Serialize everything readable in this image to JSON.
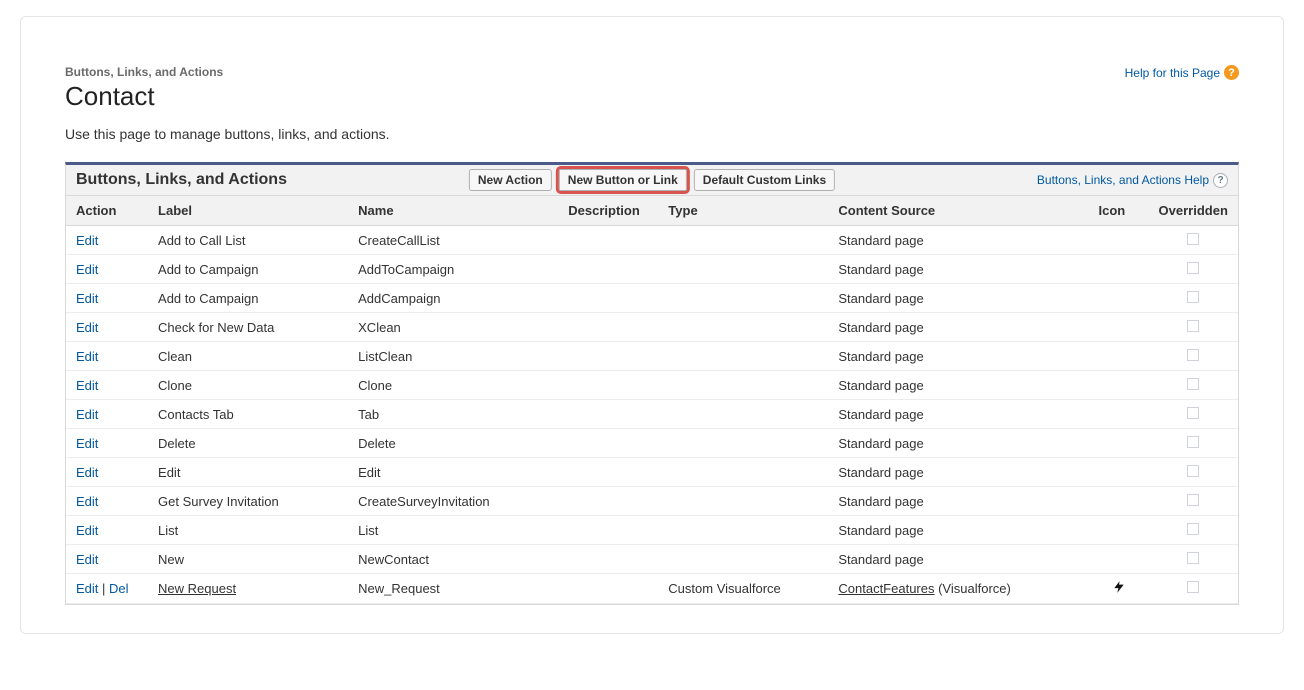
{
  "header": {
    "breadcrumb": "Buttons, Links, and Actions",
    "title": "Contact",
    "help_label": "Help for this Page"
  },
  "intro": "Use this page to manage buttons, links, and actions.",
  "panel": {
    "title": "Buttons, Links, and Actions",
    "buttons": {
      "new_action": "New Action",
      "new_button_link": "New Button or Link",
      "default_custom_links": "Default Custom Links"
    },
    "help_label": "Buttons, Links, and Actions Help"
  },
  "table": {
    "headers": {
      "action": "Action",
      "label": "Label",
      "name": "Name",
      "description": "Description",
      "type": "Type",
      "content_source": "Content Source",
      "icon": "Icon",
      "overridden": "Overridden"
    },
    "action_labels": {
      "edit": "Edit",
      "del": "Del",
      "sep": " | "
    },
    "rows": [
      {
        "actions": [
          "edit"
        ],
        "label": "Add to Call List",
        "name": "CreateCallList",
        "description": "",
        "type": "",
        "content_source": "Standard page",
        "src_link": false,
        "icon": "",
        "label_link": false
      },
      {
        "actions": [
          "edit"
        ],
        "label": "Add to Campaign",
        "name": "AddToCampaign",
        "description": "",
        "type": "",
        "content_source": "Standard page",
        "src_link": false,
        "icon": "",
        "label_link": false
      },
      {
        "actions": [
          "edit"
        ],
        "label": "Add to Campaign",
        "name": "AddCampaign",
        "description": "",
        "type": "",
        "content_source": "Standard page",
        "src_link": false,
        "icon": "",
        "label_link": false
      },
      {
        "actions": [
          "edit"
        ],
        "label": "Check for New Data",
        "name": "XClean",
        "description": "",
        "type": "",
        "content_source": "Standard page",
        "src_link": false,
        "icon": "",
        "label_link": false
      },
      {
        "actions": [
          "edit"
        ],
        "label": "Clean",
        "name": "ListClean",
        "description": "",
        "type": "",
        "content_source": "Standard page",
        "src_link": false,
        "icon": "",
        "label_link": false
      },
      {
        "actions": [
          "edit"
        ],
        "label": "Clone",
        "name": "Clone",
        "description": "",
        "type": "",
        "content_source": "Standard page",
        "src_link": false,
        "icon": "",
        "label_link": false
      },
      {
        "actions": [
          "edit"
        ],
        "label": "Contacts Tab",
        "name": "Tab",
        "description": "",
        "type": "",
        "content_source": "Standard page",
        "src_link": false,
        "icon": "",
        "label_link": false
      },
      {
        "actions": [
          "edit"
        ],
        "label": "Delete",
        "name": "Delete",
        "description": "",
        "type": "",
        "content_source": "Standard page",
        "src_link": false,
        "icon": "",
        "label_link": false
      },
      {
        "actions": [
          "edit"
        ],
        "label": "Edit",
        "name": "Edit",
        "description": "",
        "type": "",
        "content_source": "Standard page",
        "src_link": false,
        "icon": "",
        "label_link": false
      },
      {
        "actions": [
          "edit"
        ],
        "label": "Get Survey Invitation",
        "name": "CreateSurveyInvitation",
        "description": "",
        "type": "",
        "content_source": "Standard page",
        "src_link": false,
        "icon": "",
        "label_link": false
      },
      {
        "actions": [
          "edit"
        ],
        "label": "List",
        "name": "List",
        "description": "",
        "type": "",
        "content_source": "Standard page",
        "src_link": false,
        "icon": "",
        "label_link": false
      },
      {
        "actions": [
          "edit"
        ],
        "label": "New",
        "name": "NewContact",
        "description": "",
        "type": "",
        "content_source": "Standard page",
        "src_link": false,
        "icon": "",
        "label_link": false
      },
      {
        "actions": [
          "edit",
          "del"
        ],
        "label": "New Request",
        "name": "New_Request",
        "description": "",
        "type": "Custom Visualforce",
        "content_source": "ContactFeatures",
        "src_suffix": " (Visualforce)",
        "src_link": true,
        "icon": "lightning",
        "label_link": true
      }
    ]
  }
}
